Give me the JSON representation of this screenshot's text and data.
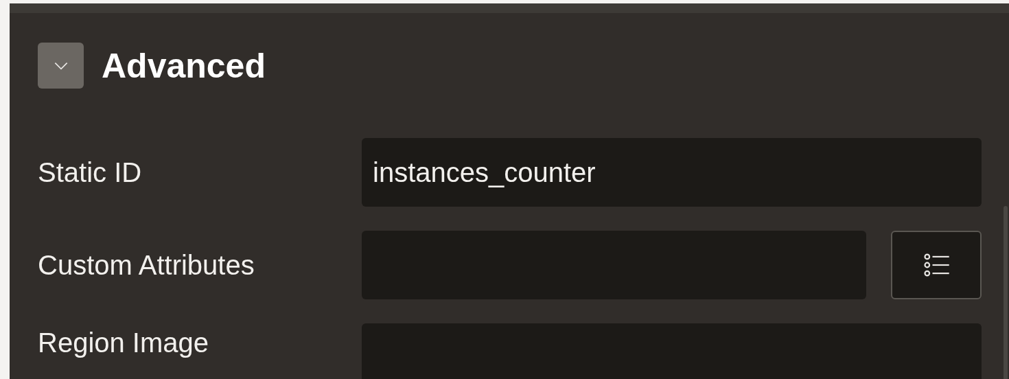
{
  "section": {
    "title": "Advanced",
    "expanded": true
  },
  "fields": [
    {
      "label": "Static ID",
      "value": "instances_counter",
      "kind": "text"
    },
    {
      "label": "Custom Attributes",
      "kind": "picker"
    },
    {
      "label": "Region Image",
      "kind": "text"
    }
  ]
}
